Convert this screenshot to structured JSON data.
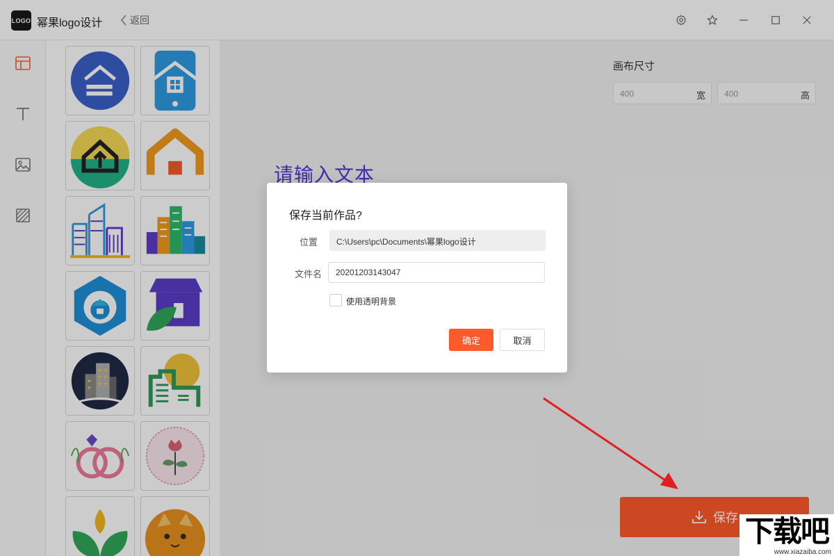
{
  "app": {
    "logo_text": "LOGO",
    "title": "幂果logo设计",
    "back_label": "返回"
  },
  "window_controls": [
    "settings-icon",
    "star-icon",
    "minimize-icon",
    "maximize-icon",
    "close-icon"
  ],
  "toolbar": {
    "tools": [
      "template-icon",
      "text-icon",
      "image-icon",
      "background-icon"
    ],
    "active": "template-icon",
    "active_color": "#ff5a2b"
  },
  "templates": [
    "house-blue-circle",
    "house-phone-tile",
    "house-arrow-teal",
    "house-orange-gradient",
    "city-buildings-outline",
    "city-buildings-colorful",
    "hexagon-home",
    "shop-leaf",
    "dark-circle-buildings",
    "green-building-sun",
    "wedding-rings",
    "rose-stamp",
    "green-leaves",
    "orange-cat"
  ],
  "canvas": {
    "placeholder_text": "请输入文本",
    "size_label": "画布尺寸",
    "width": "400",
    "width_unit": "宽",
    "height": "400",
    "height_unit": "高"
  },
  "save_button": {
    "label": "保存"
  },
  "dialog": {
    "title": "保存当前作品?",
    "location_label": "位置",
    "location_value": "C:\\Users\\pc\\Documents\\幂果logo设计",
    "filename_label": "文件名",
    "filename_value": "20201203143047",
    "transparent_label": "使用透明背景",
    "transparent_checked": false,
    "ok_label": "确定",
    "cancel_label": "取消"
  },
  "watermark": {
    "main": "下载吧",
    "sub": "www.xiazaiba.com"
  },
  "colors": {
    "accent": "#ff5a2b",
    "canvas_text": "#4a39d6",
    "arrow": "#e02020"
  }
}
